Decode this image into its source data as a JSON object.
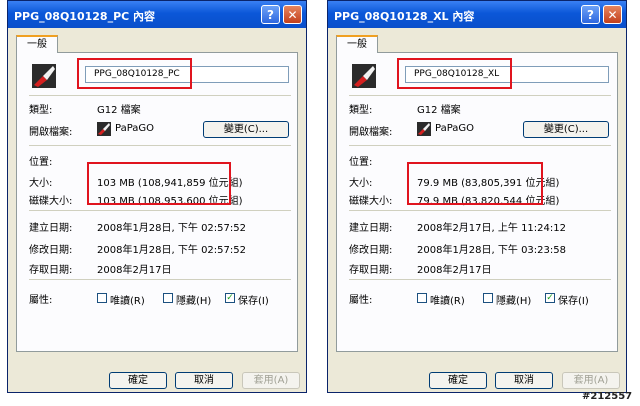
{
  "tab_label": "一般",
  "labels": {
    "type": "類型:",
    "opens_with": "開啟檔案:",
    "location": "位置:",
    "size": "大小:",
    "size_on_disk": "磁碟大小:",
    "created": "建立日期:",
    "modified": "修改日期:",
    "accessed": "存取日期:",
    "attributes": "屬性:"
  },
  "change_button": "變更(C)...",
  "attributes": {
    "readonly": "唯讀(R)",
    "hidden": "隱藏(H)",
    "archive": "保存(I)"
  },
  "buttons": {
    "ok": "確定",
    "cancel": "取消",
    "apply": "套用(A)"
  },
  "left": {
    "title": "PPG_08Q10128_PC 內容",
    "filename": "PPG_08Q10128_PC",
    "type": "G12 檔案",
    "opens_with": "PaPaGO",
    "size": "103 MB (108,941,859 位元組)",
    "size_on_disk": "103 MB (108,953,600 位元組)",
    "created": "2008年1月28日, 下午 02:57:52",
    "modified": "2008年1月28日, 下午 02:57:52",
    "accessed": "2008年2月17日"
  },
  "right": {
    "title": "PPG_08Q10128_XL 內容",
    "filename": "PPG_08Q10128_XL",
    "type": "G12 檔案",
    "opens_with": "PaPaGO",
    "size": "79.9 MB (83,805,391 位元組)",
    "size_on_disk": "79.9 MB (83,820,544 位元組)",
    "created": "2008年2月17日, 上午 11:24:12",
    "modified": "2008年1月28日, 下午 03:23:58",
    "accessed": "2008年2月17日"
  },
  "watermark": "#212557",
  "colors": {
    "highlight": "#e0141e",
    "titlebar": "#0b57d8",
    "dialog": "#ece9d8"
  }
}
